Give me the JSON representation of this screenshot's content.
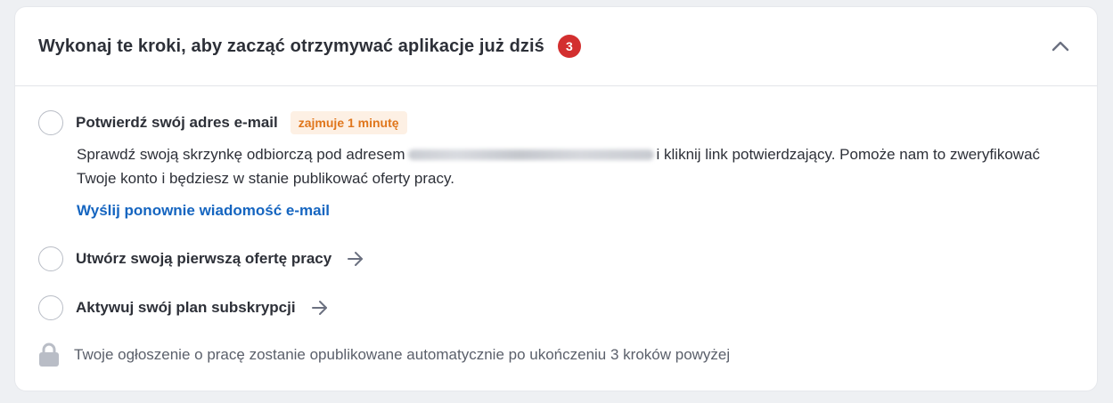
{
  "header": {
    "title": "Wykonaj te kroki, aby zacząć otrzymywać aplikacje już dziś",
    "pending_count": "3",
    "collapse_icon": "chevron-up-icon"
  },
  "steps": [
    {
      "label": "Potwierdź swój adres e-mail",
      "badge": "zajmuje 1 minutę",
      "description_before": "Sprawdź swoją skrzynkę odbiorczą pod adresem",
      "description_after": "i kliknij link potwierdzający. Pomoże nam to zweryfikować Twoje konto i będziesz w stanie publikować oferty pracy.",
      "link": "Wyślij ponownie wiadomość e-mail"
    },
    {
      "label": "Utwórz swoją pierwszą ofertę pracy",
      "icon": "arrow-right-icon"
    },
    {
      "label": "Aktywuj swój plan subskrypcji",
      "icon": "arrow-right-icon"
    }
  ],
  "footer": {
    "icon": "lock-icon",
    "text": "Twoje ogłoszenie o pracę zostanie opublikowane automatycznie po ukończeniu 3 kroków powyżej"
  },
  "colors": {
    "badge_red": "#d32f2f",
    "time_badge_bg": "#fdf0e4",
    "time_badge_text": "#e0761c",
    "link_blue": "#1565c0"
  }
}
